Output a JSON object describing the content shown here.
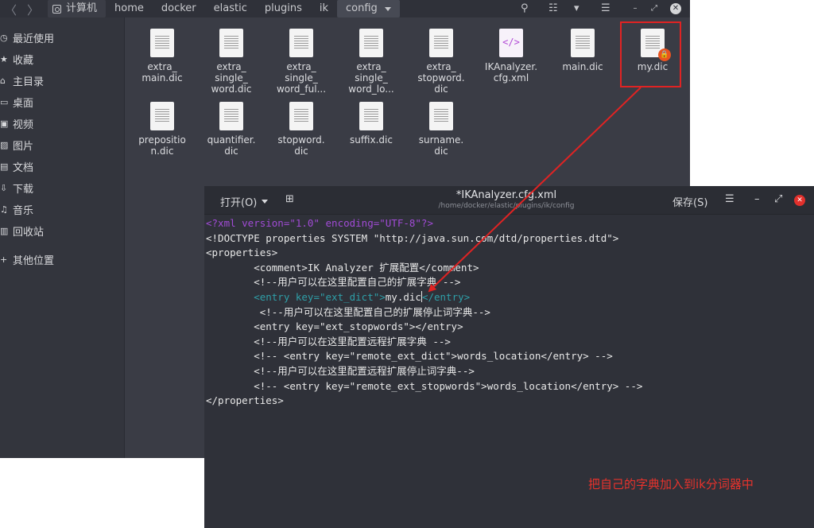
{
  "file_manager": {
    "nav": {
      "back": "〈",
      "forward": "〉"
    },
    "breadcrumbs": [
      "计算机",
      "home",
      "docker",
      "elastic",
      "plugins",
      "ik",
      "config"
    ],
    "header_icons": {
      "search": "⚲",
      "list_view": "☷",
      "view_menu": "▾",
      "menu": "☰",
      "minimize": "–",
      "maximize": "⤢",
      "close": "✕"
    },
    "sidebar": [
      {
        "glyph": "◷",
        "label": "最近使用"
      },
      {
        "glyph": "★",
        "label": "收藏"
      },
      {
        "glyph": "⌂",
        "label": "主目录"
      },
      {
        "glyph": "▭",
        "label": "桌面"
      },
      {
        "glyph": "▣",
        "label": "视频"
      },
      {
        "glyph": "▨",
        "label": "图片"
      },
      {
        "glyph": "▤",
        "label": "文档"
      },
      {
        "glyph": "⇩",
        "label": "下载"
      },
      {
        "glyph": "♫",
        "label": "音乐"
      },
      {
        "glyph": "▥",
        "label": "回收站"
      },
      {
        "glyph": "+",
        "label": "其他位置"
      }
    ],
    "files": [
      {
        "name": "extra_\nmain.dic",
        "icon": "text-document-icon"
      },
      {
        "name": "extra_\nsingle_\nword.dic",
        "icon": "text-document-icon"
      },
      {
        "name": "extra_\nsingle_\nword_ful...",
        "icon": "text-document-icon"
      },
      {
        "name": "extra_\nsingle_\nword_lo...",
        "icon": "text-document-icon"
      },
      {
        "name": "extra_\nstopword.\ndic",
        "icon": "text-document-icon"
      },
      {
        "name": "IKAnalyzer.\ncfg.xml",
        "icon": "xml-document-icon",
        "glyph": "</>"
      },
      {
        "name": "main.dic",
        "icon": "text-document-icon"
      },
      {
        "name": "my.dic",
        "icon": "text-document-icon",
        "badge": "lock-icon",
        "badge_glyph": "🔒"
      },
      {
        "name": "prepositio\nn.dic",
        "icon": "text-document-icon"
      },
      {
        "name": "quantifier.\ndic",
        "icon": "text-document-icon"
      },
      {
        "name": "stopword.\ndic",
        "icon": "text-document-icon"
      },
      {
        "name": "suffix.dic",
        "icon": "text-document-icon"
      },
      {
        "name": "surname.\ndic",
        "icon": "text-document-icon"
      }
    ]
  },
  "editor": {
    "open_label": "打开(O)",
    "newtab_glyph": "⊞",
    "title": "*IKAnalyzer.cfg.xml",
    "path": "/home/docker/elastic/plugins/ik/config",
    "save_label": "保存(S)",
    "menu_glyph": "☰",
    "minimize_glyph": "–",
    "maximize_glyph": "⤢",
    "close_glyph": "✕",
    "code_lines": [
      {
        "segments": [
          {
            "t": "<?xml version=\"1.0\" encoding=\"UTF-8\"?>",
            "c": "purple"
          }
        ]
      },
      {
        "segments": [
          {
            "t": "<!DOCTYPE properties SYSTEM \"http://java.sun.com/dtd/properties.dtd\">",
            "c": ""
          }
        ]
      },
      {
        "segments": [
          {
            "t": "<properties>",
            "c": ""
          }
        ]
      },
      {
        "segments": [
          {
            "t": "        <comment>IK Analyzer 扩展配置</comment>",
            "c": ""
          }
        ]
      },
      {
        "segments": [
          {
            "t": "        <!--用户可以在这里配置自己的扩展字典 -->",
            "c": ""
          }
        ]
      },
      {
        "segments": [
          {
            "t": "        <entry key=\"ext_dict\">",
            "c": "teal"
          },
          {
            "t": "my.dic",
            "c": ""
          },
          {
            "t": "|",
            "c": "cursor"
          },
          {
            "t": "</entry>",
            "c": "teal"
          }
        ]
      },
      {
        "segments": [
          {
            "t": "         <!--用户可以在这里配置自己的扩展停止词字典-->",
            "c": ""
          }
        ]
      },
      {
        "segments": [
          {
            "t": "        <entry key=\"ext_stopwords\"></entry>",
            "c": ""
          }
        ]
      },
      {
        "segments": [
          {
            "t": "        <!--用户可以在这里配置远程扩展字典 -->",
            "c": ""
          }
        ]
      },
      {
        "segments": [
          {
            "t": "        <!-- <entry key=\"remote_ext_dict\">words_location</entry> -->",
            "c": ""
          }
        ]
      },
      {
        "segments": [
          {
            "t": "        <!--用户可以在这里配置远程扩展停止词字典-->",
            "c": ""
          }
        ]
      },
      {
        "segments": [
          {
            "t": "        <!-- <entry key=\"remote_ext_stopwords\">words_location</entry> -->",
            "c": ""
          }
        ]
      },
      {
        "segments": [
          {
            "t": "</properties>",
            "c": ""
          }
        ]
      }
    ]
  },
  "annotation": {
    "text": "把自己的字典加入到ik分词器中",
    "color": "#e8322c"
  },
  "colors": {
    "fm_bg": "#3a3c45",
    "sidebar_bg": "#33353d",
    "editor_bg": "#2f3139",
    "xml_decl": "#a14bd6",
    "entry_tag": "#2f9fa8",
    "highlight": "#e02323",
    "lock_badge": "#e95420"
  }
}
